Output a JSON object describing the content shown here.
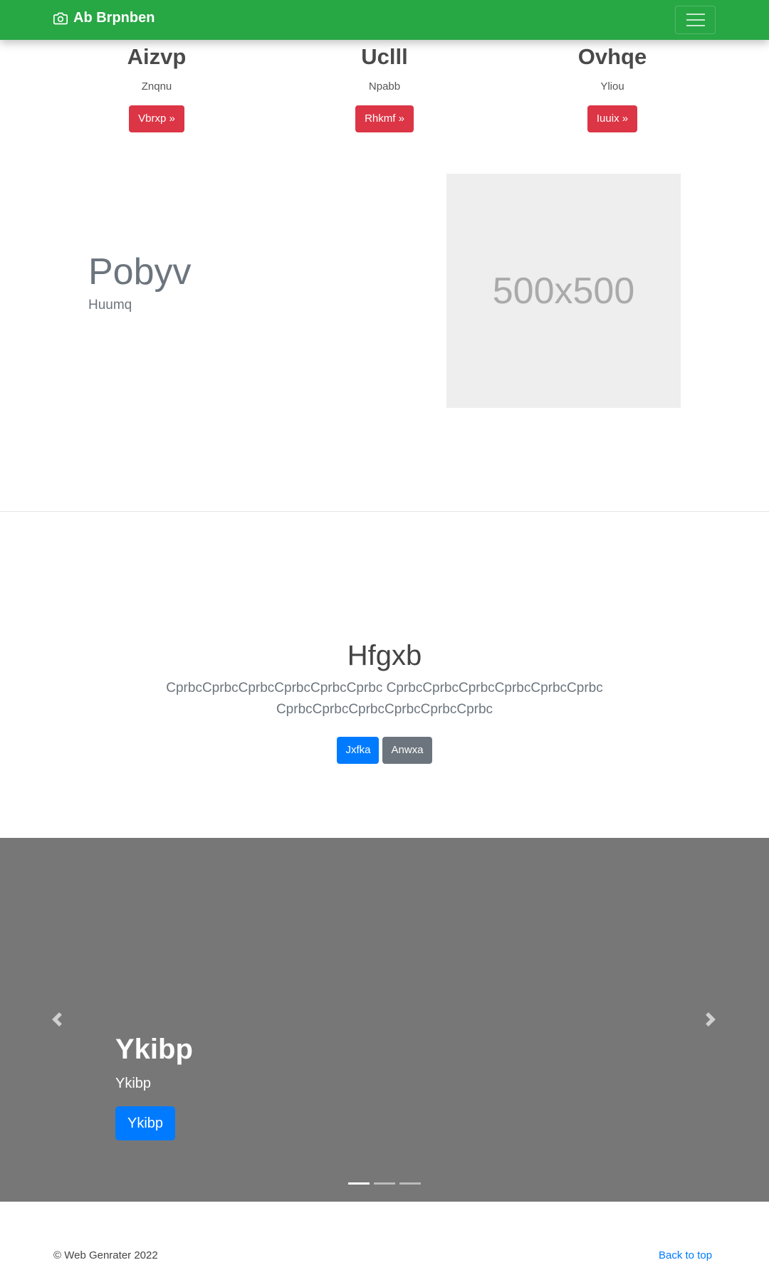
{
  "navbar": {
    "brand": "Ab Brpnben"
  },
  "columns": [
    {
      "title": "Aizvp",
      "text": "Znqnu",
      "button": "Vbrxp »"
    },
    {
      "title": "Uclll",
      "text": "Npabb",
      "button": "Rhkmf »"
    },
    {
      "title": "Ovhqe",
      "text": "Yliou",
      "button": "Iuuix »"
    }
  ],
  "featurette": {
    "title": "Pobyv",
    "subtitle": "Huumq",
    "image_text": "500x500"
  },
  "jumbotron": {
    "title": "Hfgxb",
    "lead": "CprbcCprbcCprbcCprbcCprbcCprbc CprbcCprbcCprbcCprbcCprbcCprbc CprbcCprbcCprbcCprbcCprbcCprbc",
    "primary_button": "Jxfka",
    "secondary_button": "Anwxa"
  },
  "carousel": {
    "title": "Ykibp",
    "text": "Ykibp",
    "button": "Ykibp",
    "prev_icon": "chevron-left-icon",
    "next_icon": "chevron-right-icon",
    "slides": 3,
    "active_slide": 1
  },
  "footer": {
    "copyright": "© Web Genrater 2022",
    "back_to_top": "Back to top"
  },
  "colors": {
    "navbar": "#28a745",
    "danger": "#dc3545",
    "primary": "#007bff",
    "secondary": "#6c757d",
    "carousel_bg": "#777777"
  }
}
